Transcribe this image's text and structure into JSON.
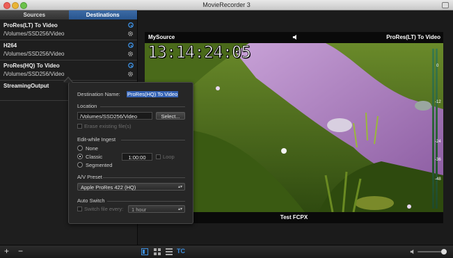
{
  "window": {
    "title": "MovieRecorder 3"
  },
  "tabs": {
    "sources": "Sources",
    "destinations": "Destinations"
  },
  "destinations": [
    {
      "name": "ProRes(LT) To Video",
      "path": "/Volumes/SSD256/Video"
    },
    {
      "name": "H264",
      "path": "/Volumes/SSD256/Video"
    },
    {
      "name": "ProRes(HQ) To Video",
      "path": "/Volumes/SSD256/Video"
    },
    {
      "name": "StreamingOutput",
      "path": ""
    }
  ],
  "popover": {
    "destination_name_label": "Destination Name:",
    "destination_name_value": "ProRes(HQ) To Video",
    "location_section": "Location",
    "location_path": "/Volumes/SSD256/Video",
    "select_button": "Select...",
    "erase_label": "Erase existing file(s)",
    "ingest_section": "Edit-while Ingest",
    "ingest_options": [
      "None",
      "Classic",
      "Segmented"
    ],
    "ingest_selected": "Classic",
    "duration_value": "1:00:00",
    "loop_label": "Loop",
    "preset_section": "A/V Preset",
    "preset_value": "Apple ProRes 422 (HQ)",
    "autoswitch_section": "Auto Switch",
    "switch_label": "Switch file every:",
    "switch_value": "1 hour"
  },
  "viewer": {
    "source_name": "MySource",
    "format_name": "ProRes(LT) To Video",
    "timecode": "13:14:24:05",
    "footer": "Test FCPX",
    "meter_ticks": [
      "0",
      "-12",
      "-24",
      "-36",
      "-48"
    ]
  },
  "bottombar": {
    "add": "+",
    "remove": "−",
    "tc": "TC"
  },
  "colors": {
    "accent": "#2f6fcc",
    "tab_selected": "#2f5e9c",
    "meter_green": "#2aa96a"
  }
}
